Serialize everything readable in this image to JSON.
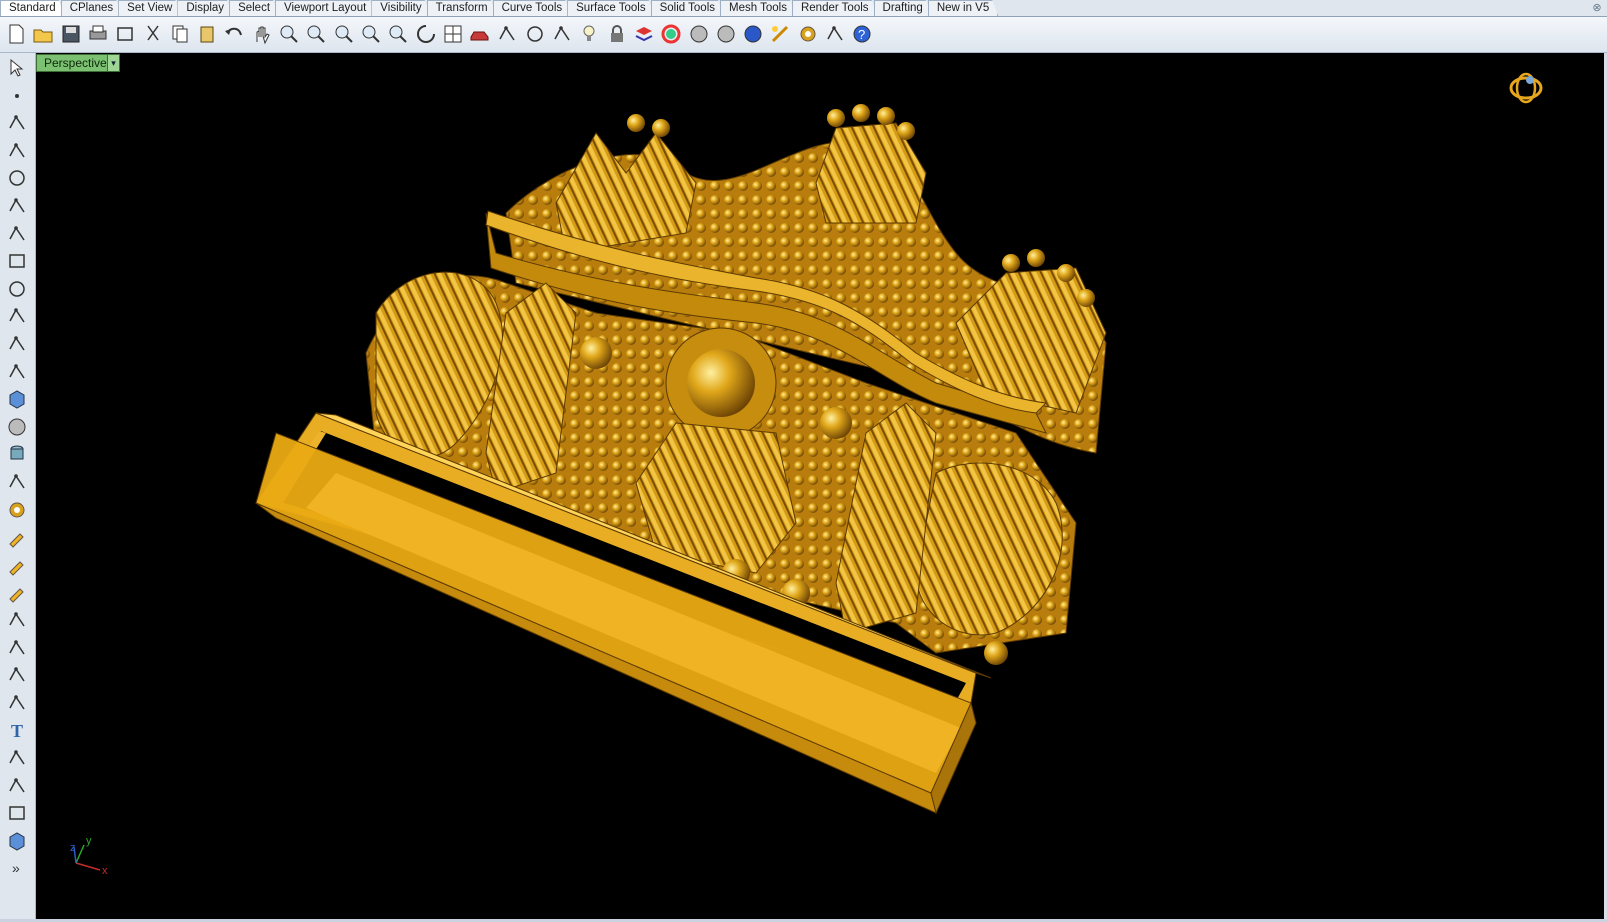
{
  "tabs": [
    "Standard",
    "CPlanes",
    "Set View",
    "Display",
    "Select",
    "Viewport Layout",
    "Visibility",
    "Transform",
    "Curve Tools",
    "Surface Tools",
    "Solid Tools",
    "Mesh Tools",
    "Render Tools",
    "Drafting",
    "New in V5"
  ],
  "viewport": {
    "name": "Perspective",
    "dropdown_glyph": "▾",
    "axis_x": "x",
    "axis_y": "y",
    "axis_z": "z",
    "background": "#000000",
    "model_color": "#d9a21e"
  },
  "toolbar_icons": [
    "new-file-icon",
    "open-file-icon",
    "save-icon",
    "print-icon",
    "export-icon",
    "cut-icon",
    "copy-icon",
    "paste-icon",
    "undo-icon",
    "pan-hand-icon",
    "move-view-icon",
    "zoom-icon",
    "zoom-window-icon",
    "zoom-extents-icon",
    "zoom-selected-icon",
    "rotate-view-icon",
    "four-viewports-icon",
    "car-icon",
    "visibility-icon",
    "target-icon",
    "snap-icon",
    "light-bulb-icon",
    "lock-icon",
    "layer-icon",
    "color-wheel-icon",
    "shaded-sphere-icon",
    "rendered-sphere-icon",
    "blue-sphere-icon",
    "render-icon",
    "settings-gear-icon",
    "grid-snap-icon",
    "help-icon"
  ],
  "left_toolbar_icons": [
    "select-arrow-icon",
    "point-icon",
    "polyline-icon",
    "curve-icon",
    "circle-icon",
    "arc-icon",
    "polygon-icon",
    "rectangle-icon",
    "ellipse-icon",
    "fillet-icon",
    "surface-icon",
    "extrude-icon",
    "box-icon",
    "sphere-icon",
    "cylinder-icon",
    "plane-icon",
    "gear-icon",
    "edit-icon",
    "split-icon",
    "trim-icon",
    "boolean-icon",
    "group-icon",
    "join-icon",
    "explode-icon",
    "text-icon",
    "dimension-icon",
    "array-icon",
    "properties-icon",
    "cube-icon",
    "more-chevron-icon"
  ],
  "window_close_glyph": "⊗"
}
